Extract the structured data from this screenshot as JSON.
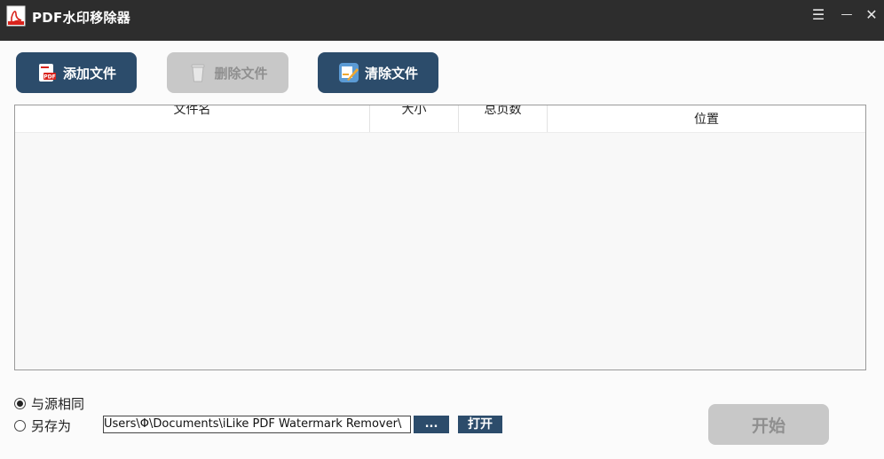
{
  "window": {
    "title": "PDF水印移除器",
    "controls": {
      "menu": "☰",
      "minimize": "—",
      "close": "✕"
    }
  },
  "toolbar": {
    "add_label": "添加文件",
    "delete_label": "删除文件",
    "clear_label": "清除文件"
  },
  "file_table": {
    "columns": [
      "文件名",
      "大小",
      "总页数",
      "位置"
    ],
    "rows": []
  },
  "output": {
    "same_as_source_label": "与源相同",
    "save_as_label": "另存为",
    "selected": "same_as_source",
    "path_value": "Users\\Φ\\Documents\\iLike PDF Watermark Remover\\",
    "browse_label": "...",
    "open_label": "打开"
  },
  "actions": {
    "start_label": "开始"
  },
  "colors": {
    "titlebar": "#2d2d2d",
    "primary_button": "#2c4c6b",
    "disabled_button": "#c8c8c8"
  }
}
